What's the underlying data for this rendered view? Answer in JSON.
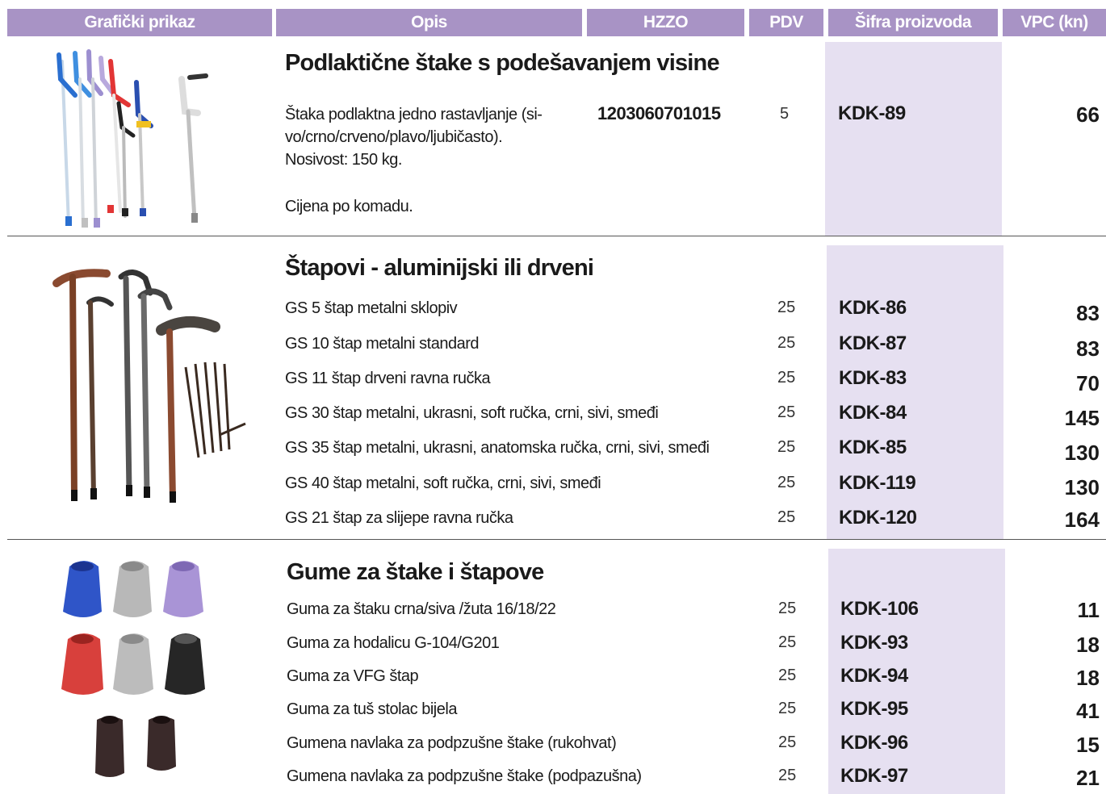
{
  "header": {
    "col_image": "Grafički prikaz",
    "col_desc": "Opis",
    "col_hzzo": "HZZO",
    "col_pdv": "PDV",
    "col_code": "Šifra proizvoda",
    "col_price": "VPC (kn)"
  },
  "colors": {
    "header_bg": "#a893c5",
    "shade": "#e6e0f1"
  },
  "section1": {
    "title": "Podlaktične štake s podešavanjem visine",
    "desc_line1": "Štaka podlaktna jedno rastavljanje (si-",
    "desc_line2": "vo/crno/crveno/plavo/ljubičasto).",
    "desc_line3": "Nosivost: 150 kg.",
    "desc_line4": "Cijena po komadu.",
    "hzzo": "1203060701015",
    "pdv": "5",
    "code": "KDK-89",
    "price": "66"
  },
  "section2": {
    "title": "Štapovi - aluminijski ili drveni",
    "rows": [
      {
        "desc": "GS 5 štap metalni sklopiv",
        "pdv": "25",
        "code": "KDK-86",
        "price": "83"
      },
      {
        "desc": "GS 10 štap metalni standard",
        "pdv": "25",
        "code": "KDK-87",
        "price": "83"
      },
      {
        "desc": "GS 11 štap drveni ravna ručka",
        "pdv": "25",
        "code": "KDK-83",
        "price": "70"
      },
      {
        "desc": "GS 30 štap metalni, ukrasni, soft ručka, crni, sivi, smeđi",
        "pdv": "25",
        "code": "KDK-84",
        "price": "145"
      },
      {
        "desc": "GS 35 štap metalni, ukrasni, anatomska ručka, crni, sivi, smeđi",
        "pdv": "25",
        "code": "KDK-85",
        "price": "130"
      },
      {
        "desc": "GS 40 štap metalni, soft ručka, crni, sivi, smeđi",
        "pdv": "25",
        "code": "KDK-119",
        "price": "130"
      },
      {
        "desc": "GS 21 štap za slijepe ravna ručka",
        "pdv": "25",
        "code": "KDK-120",
        "price": "164"
      }
    ]
  },
  "section3": {
    "title": "Gume za štake i štapove",
    "rows": [
      {
        "desc": "Guma za štaku crna/siva /žuta 16/18/22",
        "pdv": "25",
        "code": "KDK-106",
        "price": "11"
      },
      {
        "desc": "Guma za hodalicu G-104/G201",
        "pdv": "25",
        "code": "KDK-93",
        "price": "18"
      },
      {
        "desc": "Guma za VFG štap",
        "pdv": "25",
        "code": "KDK-94",
        "price": "18"
      },
      {
        "desc": "Guma za tuš stolac bijela",
        "pdv": "25",
        "code": "KDK-95",
        "price": "41"
      },
      {
        "desc": "Gumena navlaka za podpzušne štake  (rukohvat)",
        "pdv": "25",
        "code": "KDK-96",
        "price": "15"
      },
      {
        "desc": "Gumena navlaka za podpzušne štake  (podpazušna)",
        "pdv": "25",
        "code": "KDK-97",
        "price": "21"
      }
    ]
  },
  "icons": [
    "crutches-image",
    "walking-sticks-image",
    "rubber-tips-image"
  ]
}
